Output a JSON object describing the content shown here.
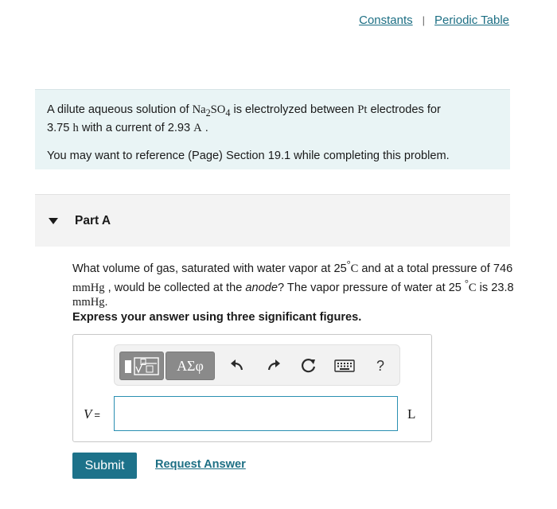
{
  "header": {
    "links": [
      "Constants",
      "Periodic Table"
    ],
    "separator": "|"
  },
  "intro": {
    "line1_a": "A dilute aqueous solution of ",
    "formula_na": "Na",
    "formula_na_sub": "2",
    "formula_so": "SO",
    "formula_so_sub": "4",
    "line1_b": " is electrolyzed between ",
    "electrode": "Pt",
    "line1_c": " electrodes for",
    "time_value": "3.75 ",
    "time_unit": "h",
    "line2_b": " with a current of 2.93 ",
    "current_unit": "A",
    "line2_end": " .",
    "reference": "You may want to reference (Page) Section 19.1 while completing this problem."
  },
  "part": {
    "title": "Part A"
  },
  "question": {
    "t1": "What volume of gas, saturated with water vapor at 25",
    "deg1": "°",
    "unit_c1": "C",
    "t2": " and at a total pressure of 746 ",
    "unit_mmhg1": "mmHg",
    "t3": " , would be collected at the ",
    "anode": "anode",
    "t4": "? The vapor pressure of water at 25 ",
    "deg2": "°",
    "unit_c2": "C",
    "t5": " is 23.8 ",
    "unit_mmhg2": "mmHg",
    "t6": ".",
    "instruction": "Express your answer using three significant figures."
  },
  "toolbar": {
    "greek_label": "ΑΣφ",
    "help_label": "?",
    "icons": [
      "templates-icon",
      "greek-symbols-icon",
      "undo-icon",
      "redo-icon",
      "reset-icon",
      "keyboard-icon",
      "help-icon"
    ]
  },
  "answer": {
    "variable": "V",
    "equals": "=",
    "value": "",
    "unit": "L"
  },
  "actions": {
    "submit": "Submit",
    "request": "Request Answer"
  },
  "colors": {
    "link": "#1d6f84",
    "intro_bg": "#e9f4f5",
    "part_bg": "#f3f3f3",
    "submit_bg": "#1d728a",
    "input_border": "#2a8fb2",
    "tool_button": "#8a8a8a"
  }
}
